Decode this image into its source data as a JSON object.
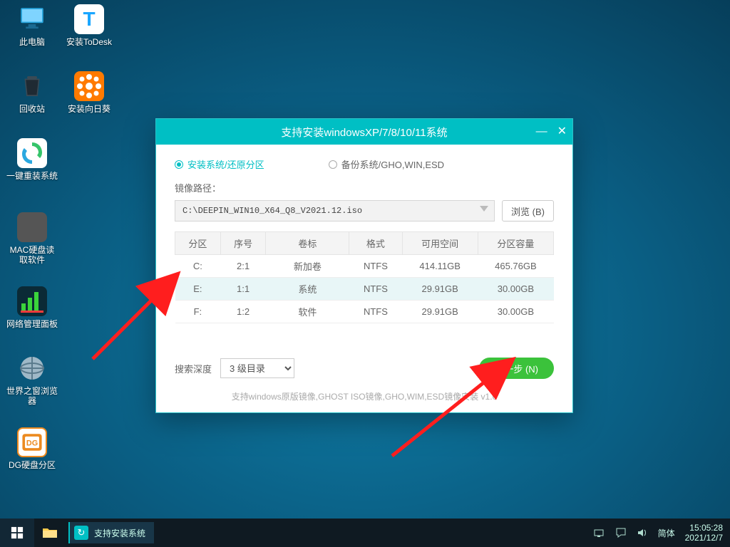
{
  "desktop_icons": {
    "this_pc": "此电脑",
    "todesk": "安装ToDesk",
    "recycle": "回收站",
    "sunflower": "安装向日葵",
    "reinstall": "一键重装系统",
    "macread": "MAC硬盘读\n取软件",
    "netpanel": "网络管理面板",
    "browser": "世界之窗浏览\n器",
    "dgdisk": "DG硬盘分区"
  },
  "installer": {
    "title": "支持安装windowsXP/7/8/10/11系统",
    "tab_install": "安装系统/还原分区",
    "tab_backup": "备份系统/GHO,WIN,ESD",
    "path_label": "镜像路径：",
    "path_value": "C:\\DEEPIN_WIN10_X64_Q8_V2021.12.iso",
    "browse": "浏览 (B)",
    "headers": {
      "part": "分区",
      "seq": "序号",
      "vol": "卷标",
      "fmt": "格式",
      "free": "可用空间",
      "size": "分区容量"
    },
    "rows": [
      {
        "part": "C:",
        "seq": "2:1",
        "vol": "新加卷",
        "fmt": "NTFS",
        "free": "414.11GB",
        "size": "465.76GB"
      },
      {
        "part": "E:",
        "seq": "1:1",
        "vol": "系统",
        "fmt": "NTFS",
        "free": "29.91GB",
        "size": "30.00GB"
      },
      {
        "part": "F:",
        "seq": "1:2",
        "vol": "软件",
        "fmt": "NTFS",
        "free": "29.91GB",
        "size": "30.00GB"
      }
    ],
    "depth_label": "搜索深度",
    "depth_value": "3 级目录",
    "next": "下一步 (N)",
    "hint": "支持windows原版镜像,GHOST ISO镜像,GHO,WIM,ESD镜像安装    v1.0"
  },
  "taskbar": {
    "task_label": "支持安装系统",
    "ime": "简体",
    "time": "15:05:28",
    "date": "2021/12/7"
  }
}
